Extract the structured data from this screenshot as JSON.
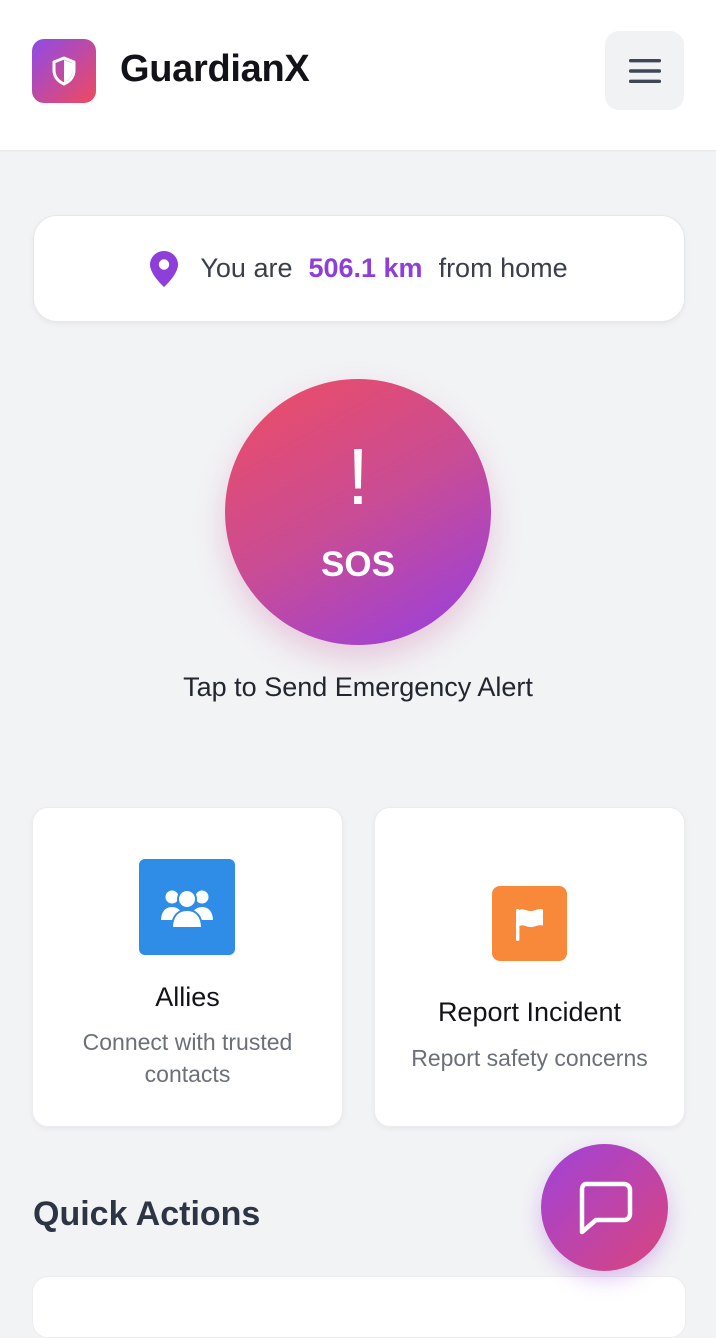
{
  "header": {
    "app_name": "GuardianX"
  },
  "location": {
    "prefix": "You are",
    "distance": "506.1 km",
    "suffix": "from home"
  },
  "sos": {
    "symbol": "!",
    "label": "SOS",
    "caption": "Tap to Send Emergency Alert"
  },
  "cards": [
    {
      "title": "Allies",
      "description": "Connect with trusted contacts",
      "icon": "users-icon"
    },
    {
      "title": "Report Incident",
      "description": "Report safety concerns",
      "icon": "flag-icon"
    }
  ],
  "quick_actions": {
    "title": "Quick Actions"
  },
  "colors": {
    "accent_purple": "#8e3fd9",
    "sos_gradient_start": "#ef4d62",
    "sos_gradient_end": "#963fe3",
    "allies_blue": "#2f8de8",
    "report_orange": "#f8883a"
  }
}
